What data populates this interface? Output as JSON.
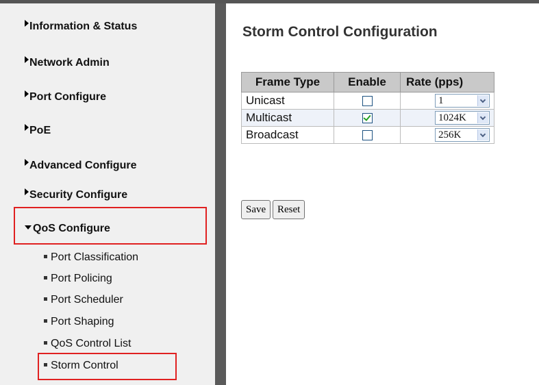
{
  "sidebar": {
    "menus": [
      {
        "label": "Information & Status"
      },
      {
        "label": "Network Admin"
      },
      {
        "label": "Port Configure"
      },
      {
        "label": "PoE"
      },
      {
        "label": "Advanced Configure"
      },
      {
        "label": "Security Configure"
      },
      {
        "label": "QoS Configure"
      }
    ],
    "submenu": [
      {
        "label": "Port Classification"
      },
      {
        "label": "Port Policing"
      },
      {
        "label": "Port Scheduler"
      },
      {
        "label": "Port Shaping"
      },
      {
        "label": "QoS Control List"
      },
      {
        "label": "Storm Control"
      }
    ],
    "highlight_color": "#e02020"
  },
  "main": {
    "title": "Storm Control Configuration",
    "columns": [
      "Frame Type",
      "Enable",
      "Rate (pps)"
    ],
    "rows": [
      {
        "frame_type": "Unicast",
        "enabled": false,
        "rate": "1"
      },
      {
        "frame_type": "Multicast",
        "enabled": true,
        "rate": "1024K"
      },
      {
        "frame_type": "Broadcast",
        "enabled": false,
        "rate": "256K"
      }
    ],
    "buttons": {
      "save": "Save",
      "reset": "Reset"
    }
  }
}
